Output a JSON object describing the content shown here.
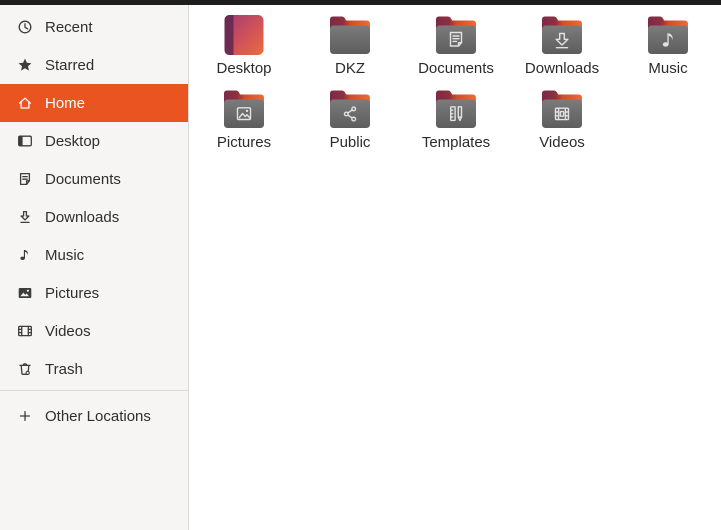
{
  "colors": {
    "accent": "#E95420",
    "topbar": "#1E1E1E",
    "sidebar_bg": "#F6F5F4",
    "main_bg": "#FFFFFF",
    "folder_body_gray": "#6B6B6B",
    "folder_flap_maroon": "#7C2A47",
    "folder_flap_orange": "#EE6B37",
    "desktop_icon_strip": "#64284F",
    "desktop_icon_start": "#A03B73",
    "desktop_icon_end": "#EC6C3E"
  },
  "sidebar": {
    "items": [
      {
        "label": "Recent",
        "icon": "recent-icon",
        "selected": false
      },
      {
        "label": "Starred",
        "icon": "starred-icon",
        "selected": false
      },
      {
        "label": "Home",
        "icon": "home-icon",
        "selected": true
      },
      {
        "label": "Desktop",
        "icon": "desktop-icon",
        "selected": false
      },
      {
        "label": "Documents",
        "icon": "documents-icon",
        "selected": false
      },
      {
        "label": "Downloads",
        "icon": "downloads-icon",
        "selected": false
      },
      {
        "label": "Music",
        "icon": "music-icon",
        "selected": false
      },
      {
        "label": "Pictures",
        "icon": "pictures-icon",
        "selected": false
      },
      {
        "label": "Videos",
        "icon": "videos-icon",
        "selected": false
      },
      {
        "label": "Trash",
        "icon": "trash-icon",
        "selected": false
      }
    ],
    "other": {
      "label": "Other Locations",
      "icon": "plus-icon"
    }
  },
  "content": {
    "view": "icon-grid",
    "folders": [
      {
        "name": "Desktop",
        "icon": "desktop-folder-icon"
      },
      {
        "name": "DKZ",
        "icon": "plain-folder-icon"
      },
      {
        "name": "Documents",
        "icon": "documents-folder-icon"
      },
      {
        "name": "Downloads",
        "icon": "downloads-folder-icon"
      },
      {
        "name": "Music",
        "icon": "music-folder-icon"
      },
      {
        "name": "Pictures",
        "icon": "pictures-folder-icon"
      },
      {
        "name": "Public",
        "icon": "public-folder-icon"
      },
      {
        "name": "Templates",
        "icon": "templates-folder-icon"
      },
      {
        "name": "Videos",
        "icon": "videos-folder-icon"
      }
    ]
  }
}
